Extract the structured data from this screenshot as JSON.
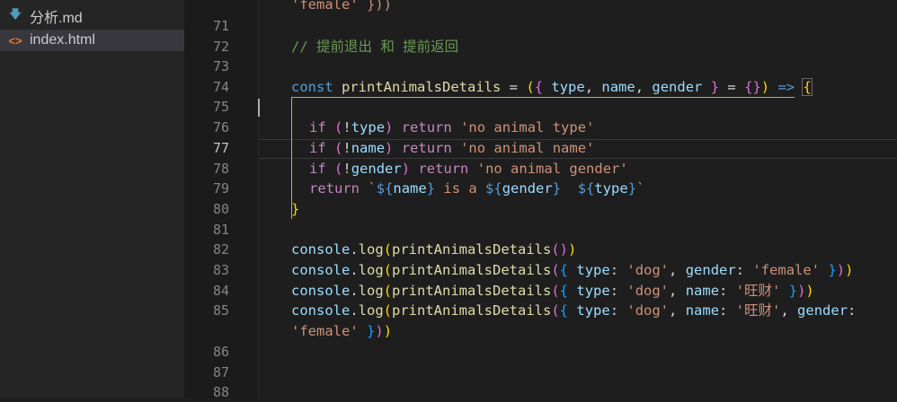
{
  "explorer": {
    "files": [
      {
        "name": "分析.md",
        "icon": "markdown-icon",
        "active": false
      },
      {
        "name": "index.html",
        "icon": "html-icon",
        "active": true
      }
    ]
  },
  "editor": {
    "line_numbers": [
      "71",
      "72",
      "73",
      "74",
      "75",
      "76",
      "77",
      "78",
      "79",
      "80",
      "81",
      "82",
      "83",
      "84",
      "85",
      "86",
      "87",
      "88"
    ],
    "current_line": "77",
    "lines": {
      "l70b": "'female' }))",
      "l72": "// 提前退出 和 提前返回",
      "l74": "const printAnimalsDetails = ({ type, name, gender } = {}) => {",
      "l76": "if (!type) return 'no animal type'",
      "l77": "if (!name) return 'no animal name'",
      "l78": "if (!gender) return 'no animal gender'",
      "l79": "return `${name} is a ${gender}  ${type}`",
      "l80": "}",
      "l82": "console.log(printAnimalsDetails())",
      "l83": "console.log(printAnimalsDetails({ type: 'dog', gender: 'female' }))",
      "l84": "console.log(printAnimalsDetails({ type: 'dog', name: '旺财' }))",
      "l85a": "console.log(printAnimalsDetails({ type: 'dog', name: '旺财', gender:",
      "l85b": "'female' }))"
    }
  }
}
